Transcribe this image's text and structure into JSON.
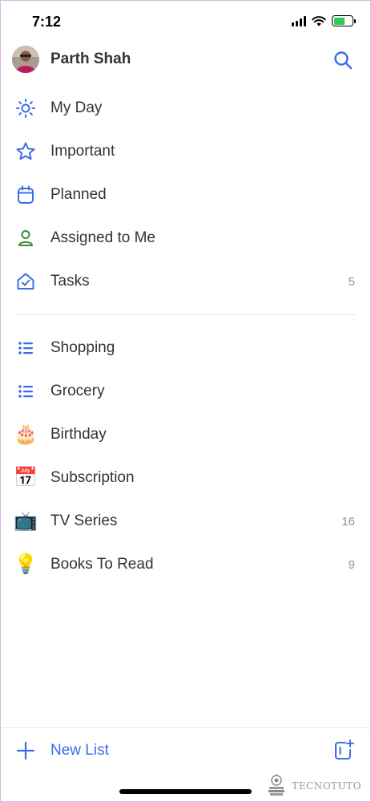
{
  "status_bar": {
    "time": "7:12"
  },
  "header": {
    "user_name": "Parth Shah"
  },
  "smart_lists": [
    {
      "label": "My Day",
      "icon": "sun-icon",
      "count": ""
    },
    {
      "label": "Important",
      "icon": "star-icon",
      "count": ""
    },
    {
      "label": "Planned",
      "icon": "calendar-icon",
      "count": ""
    },
    {
      "label": "Assigned to Me",
      "icon": "person-icon",
      "count": ""
    },
    {
      "label": "Tasks",
      "icon": "home-check-icon",
      "count": "5"
    }
  ],
  "custom_lists": [
    {
      "label": "Shopping",
      "icon": "list-icon",
      "count": ""
    },
    {
      "label": "Grocery",
      "icon": "list-icon",
      "count": ""
    },
    {
      "label": "Birthday",
      "icon": "🎂",
      "count": ""
    },
    {
      "label": "Subscription",
      "icon": "📅",
      "count": ""
    },
    {
      "label": "TV Series",
      "icon": "📺",
      "count": "16"
    },
    {
      "label": "Books To Read",
      "icon": "💡",
      "count": "9"
    }
  ],
  "footer": {
    "new_list_label": "New List"
  },
  "watermark": {
    "text": "TECNOTUTO"
  },
  "colors": {
    "accent": "#3a6ee8",
    "assigned": "#3e8b3b",
    "text": "#333333",
    "muted": "#8e8e93",
    "battery": "#34c759"
  }
}
